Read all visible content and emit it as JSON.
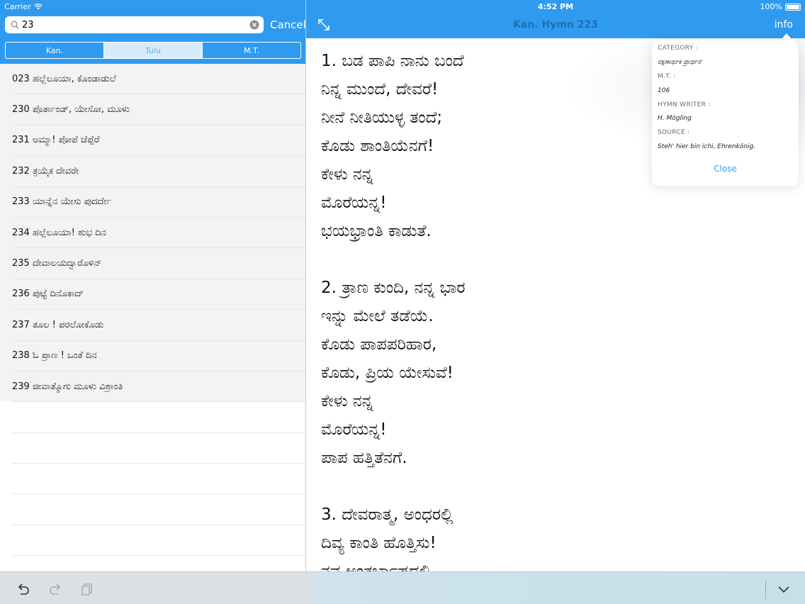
{
  "status": {
    "carrier": "Carrier",
    "time": "4:52 PM",
    "battery": "100%"
  },
  "search": {
    "value": "23",
    "cancel_label": "Cancel"
  },
  "segments": [
    {
      "label": "Kan.",
      "selected": false
    },
    {
      "label": "Tulu",
      "selected": true
    },
    {
      "label": "M.T.",
      "selected": false
    }
  ],
  "list": [
    "023 ಹಲ್ಲೆಲೂಯಾ, ಕೊಂಡಾಡುಲೆ",
    "230 ಪೊರ್ತಾಂಡ್, ಯೇಸೋ, ಮೂಳು",
    "231 ಅಮ್ಮಾ! ಪೋಪೆ ಜೆಪ್ಪೆರೆ",
    "232 ತ್ರಯೈಕ ದೇವರೇ",
    "233 ಯಾನ್ನೆನ ಯೇಸು ಪುದರ್ದೇ",
    "234 ಹಲ್ಲೆಲೂಯಾ! ಶುಭ ದಿನ",
    "235 ದೇವಾಲಯದ್ವಾರೊಳಿನ್",
    "236 ಪುಟ್ಟೆ ದಿನೊಕಾದ್",
    "237 ತೂಲ ! ಪರಲೋಕೊಡು",
    "238 ಓ ಪ್ರಾಣ ! ಒಂತೆ ದಿನ",
    "239 ಜೀವಾತ್ಮೊಗು ಮೂಳು ವಿಶ್ರಾಂತಿ"
  ],
  "header": {
    "title": "Kan. Hymn 223",
    "info_label": "info"
  },
  "lyrics": [
    "1. ಬಡ ಪಾಪಿ ನಾನು ಬಂದೆ",
    "ನಿನ್ನ ಮುಂದೆ, ದೇವರೆ!",
    "ನೀನೆ ನೀತಿಯುಳ್ಳ ತಂದೆ;",
    "ಕೊಡು ಶಾಂತಿಯೆನಗೆ!",
    "ಕೇಳು ನನ್ನ",
    "ಮೊರೆಯನ್ನ!",
    "ಭಯಭ್ರಾಂತಿ ಕಾಡುತೆ.",
    "",
    "2. ತ್ರಾಣ ಕುಂದಿ, ನನ್ನ ಭಾರ",
    "ಇನ್ನು ಮೇಲೆ ತಡೆಯೆ.",
    "ಕೊಡು ಪಾಪಪರಿಹಾರ,",
    "ಕೊಡು, ಪ್ರಿಯ ಯೇಸುವೆ!",
    "ಕೇಳು ನನ್ನ",
    "ಮೊರೆಯನ್ನ!",
    "ಪಾಪ ಹತ್ತಿತೆನಗೆ.",
    "",
    "3. ದೇವರಾತ್ಮ, ಅಂಧರಲ್ಲಿ",
    "ದಿವ್ಯ ಕಾಂತಿ ಹೊತ್ತಿಸು!",
    "ನವ ಅಂತರ್ಬಾಷದಲ್ಲಿ"
  ],
  "popover": {
    "category_label": "CATEGORY :",
    "category_value": "ರಕ್ಷಣಾರ್ಥಕ ಪ್ರಾರ್ಥನೆ",
    "mt_label": "M.T. :",
    "mt_value": "106",
    "writer_label": "HYMN WRITER :",
    "writer_value": "H. Mögling",
    "source_label": "SOURCE :",
    "source_value": "Steh' hier bin ichi, Ehrenkönig.",
    "close_label": "Close"
  },
  "icons": {
    "search": "search-icon",
    "clear": "clear-icon",
    "expand": "expand-icon",
    "undo": "undo-icon",
    "redo": "redo-icon",
    "paste": "paste-icon",
    "keyboard_hide": "chevron-down-icon"
  },
  "colors": {
    "accent": "#2f9bf0",
    "title": "#1d6fb5",
    "link": "#3aa0e6"
  }
}
